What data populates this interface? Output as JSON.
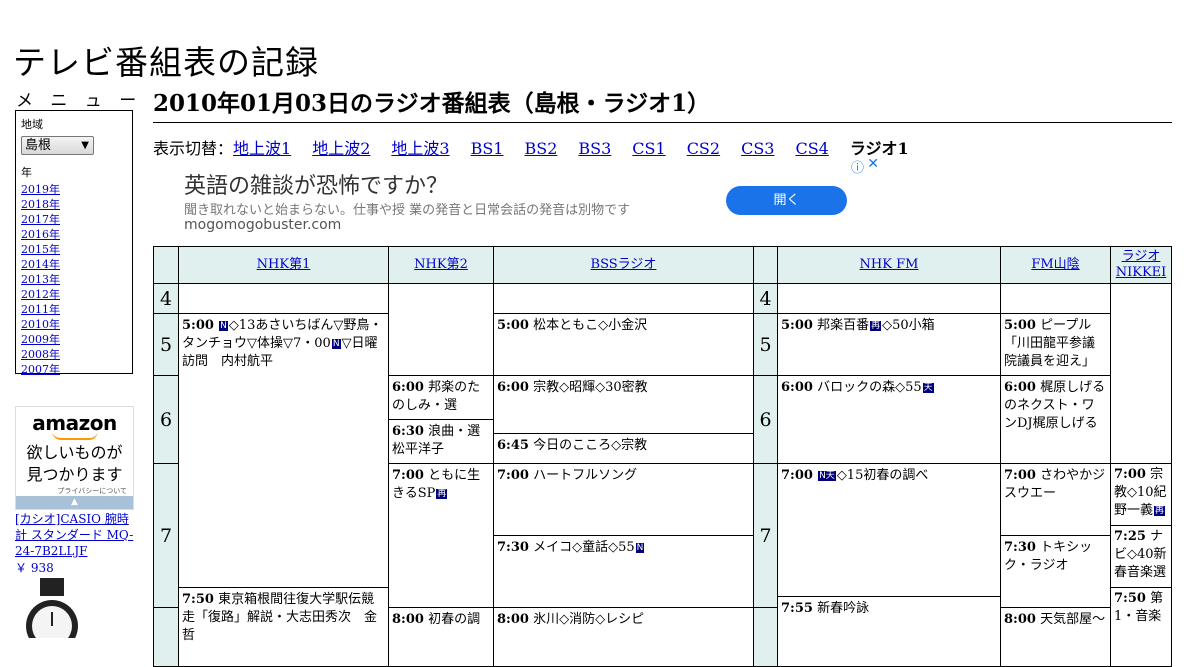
{
  "site": {
    "title": "テレビ番組表の記録"
  },
  "menu": {
    "label": "メ ニ ュ ー",
    "region_label": "地域",
    "region_value": "島根",
    "year_label": "年",
    "years": [
      "2019年",
      "2018年",
      "2017年",
      "2016年",
      "2015年",
      "2014年",
      "2013年",
      "2012年",
      "2011年",
      "2010年",
      "2009年",
      "2008年",
      "2007年"
    ]
  },
  "amazon": {
    "logo": "amazon",
    "text1": "欲しいものが",
    "text2": "見つかります",
    "privacy": "プライバシーについて",
    "bar": "▲",
    "product": "[カシオ]CASIO 腕時計 スタンダード MQ-24-7B2LLJF",
    "price": "￥ 938"
  },
  "page": {
    "heading": "2010年01月03日のラジオ番組表（島根・ラジオ1）"
  },
  "switcher": {
    "label": "表示切替：",
    "links": [
      "地上波1",
      "地上波2",
      "地上波3",
      "BS1",
      "BS2",
      "BS3",
      "CS1",
      "CS2",
      "CS3",
      "CS4"
    ],
    "current": "ラジオ1"
  },
  "ad": {
    "title": "英語の雑談が恐怖ですか？",
    "desc": "聞き取れないと始まらない。仕事や授 業の発音と日常会話の発音は別物です",
    "domain": "mogomogobuster.com",
    "open": "開く",
    "info": "ⓘ",
    "close": "✕"
  },
  "channels": {
    "nhk1": "NHK第1",
    "nhk2": "NHK第2",
    "bss": "BSSラジオ",
    "nhkfm": "NHK FM",
    "fmsanin": "FM山陰",
    "nikkei": "ラジオNIKKEI"
  },
  "hours": {
    "h4": "4",
    "h5": "5",
    "h6": "6",
    "h7": "7"
  },
  "programs": {
    "nhk1_500_time": "5:00",
    "nhk1_500_a": "◇13あさいちばん▽野鳥・タンチョウ▽体操▽7・00",
    "nhk1_500_b": "▽日曜訪問　内村航平",
    "nhk1_750_time": "7:50",
    "nhk1_750": "東京箱根間往復大学駅伝競走「復路」解説・大志田秀次　金哲",
    "nhk2_600_time": "6:00",
    "nhk2_600": "邦楽のたのしみ・選",
    "nhk2_630_time": "6:30",
    "nhk2_630": "浪曲・選　松平洋子",
    "nhk2_700_time": "7:00",
    "nhk2_700": "ともに生きるSP",
    "nhk2_800_time": "8:00",
    "nhk2_800": "初春の調",
    "bss_500_time": "5:00",
    "bss_500": "松本ともこ◇小金沢",
    "bss_600_time": "6:00",
    "bss_600": "宗教◇昭輝◇30密教",
    "bss_645_time": "6:45",
    "bss_645": "今日のこころ◇宗教",
    "bss_700_time": "7:00",
    "bss_700": "ハートフルソング",
    "bss_730_time": "7:30",
    "bss_730": "メイコ◇童話◇55",
    "bss_800_time": "8:00",
    "bss_800": "氷川◇消防◇レシピ",
    "fm_500_time": "5:00",
    "fm_500_a": "邦楽百番",
    "fm_500_b": "◇50小箱",
    "fm_600_time": "6:00",
    "fm_600": "バロックの森◇55",
    "fm_700_time": "7:00",
    "fm_700": "◇15初春の調べ",
    "fm_755_time": "7:55",
    "fm_755": "新春吟詠",
    "san_500_time": "5:00",
    "san_500": "ピープル「川田龍平参議院議員を迎え」",
    "san_600_time": "6:00",
    "san_600": "梶原しげるのネクスト・ワンDJ梶原しげる",
    "san_700_time": "7:00",
    "san_700": "さわやかジスウエー",
    "san_730_time": "7:30",
    "san_730": "トキシック・ラジオ",
    "san_800_time": "8:00",
    "san_800": "天気部屋～",
    "nik_700_time": "7:00",
    "nik_700": "宗教◇10紀野一義",
    "nik_725_time": "7:25",
    "nik_725": "ナビ◇40新春音楽選",
    "nik_750_time": "7:50",
    "nik_750": "第1・音楽"
  },
  "icons": {
    "n": "N",
    "re": "再",
    "ten": "天",
    "ni": "N天"
  }
}
